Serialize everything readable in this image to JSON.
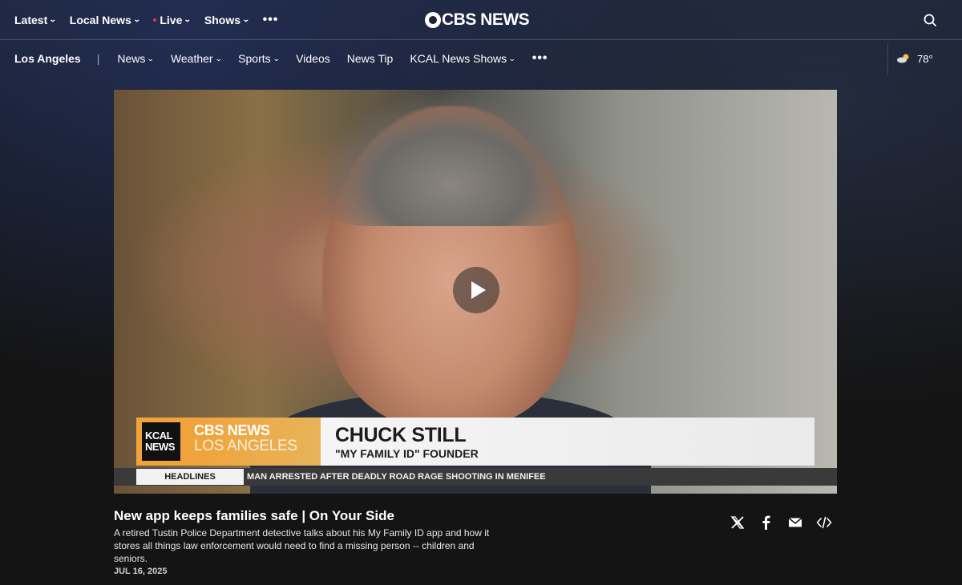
{
  "topnav": {
    "items": [
      {
        "label": "Latest"
      },
      {
        "label": "Local News"
      },
      {
        "label": "Live"
      },
      {
        "label": "Shows"
      }
    ]
  },
  "logo": {
    "text": "CBS NEWS"
  },
  "subnav": {
    "city": "Los Angeles",
    "separator": "|",
    "items": [
      {
        "label": "News"
      },
      {
        "label": "Weather"
      },
      {
        "label": "Sports"
      },
      {
        "label": "Videos"
      },
      {
        "label": "News Tip"
      },
      {
        "label": "KCAL News Shows"
      }
    ],
    "weather": {
      "temp": "78°",
      "icon": "partly-sunny-icon"
    }
  },
  "video": {
    "lower_third": {
      "station_line1": "KCAL",
      "station_line2": "NEWS",
      "brand_line1": "CBS NEWS",
      "brand_line2": "LOS ANGELES",
      "name": "CHUCK STILL",
      "subtitle": "\"MY FAMILY ID\" FOUNDER"
    },
    "ticker": {
      "label": "HEADLINES",
      "text": "MAN ARRESTED AFTER DEADLY ROAD RAGE SHOOTING IN MENIFEE"
    }
  },
  "article": {
    "title": "New app keeps families safe | On Your Side",
    "description": "A retired Tustin Police Department detective talks about his My Family ID app and how it stores all things law enforcement would need to find a missing person -- children and seniors.",
    "date": "JUL 16, 2025"
  },
  "colors": {
    "accent_orange": "#f0a33a",
    "live_red": "#e53935",
    "background": "#141414"
  }
}
